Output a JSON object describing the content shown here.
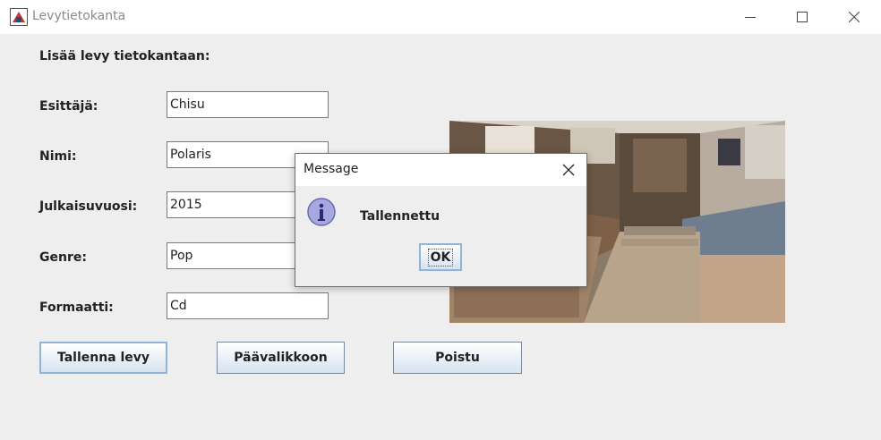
{
  "window": {
    "title": "Levytietokanta",
    "icon": "java-app-icon",
    "controls": [
      "minimize-icon",
      "maximize-icon",
      "close-icon"
    ]
  },
  "form": {
    "heading": "Lisää levy tietokantaan:",
    "fields": [
      {
        "label": "Esittäjä:",
        "value": "Chisu"
      },
      {
        "label": "Nimi:",
        "value": "Polaris"
      },
      {
        "label": "Julkaisuvuosi:",
        "value": "2015"
      },
      {
        "label": "Genre:",
        "value": "Pop"
      },
      {
        "label": "Formaatti:",
        "value": "Cd"
      }
    ]
  },
  "buttons": {
    "save": "Tallenna levy",
    "main_menu": "Päävalikkoon",
    "exit": "Poistu"
  },
  "image": {
    "subject": "record-store-photo"
  },
  "dialog": {
    "title": "Message",
    "icon": "info-icon",
    "message": "Tallennettu",
    "ok": "OK"
  },
  "colors": {
    "window_bg": "#eeeeee",
    "titlebar_bg": "#ffffff",
    "button_gradient_top": "#ffffff",
    "button_gradient_bottom": "#d6e3f0",
    "focus_border": "#8fb4d8",
    "info_icon_fill": "#a8a8e0"
  }
}
